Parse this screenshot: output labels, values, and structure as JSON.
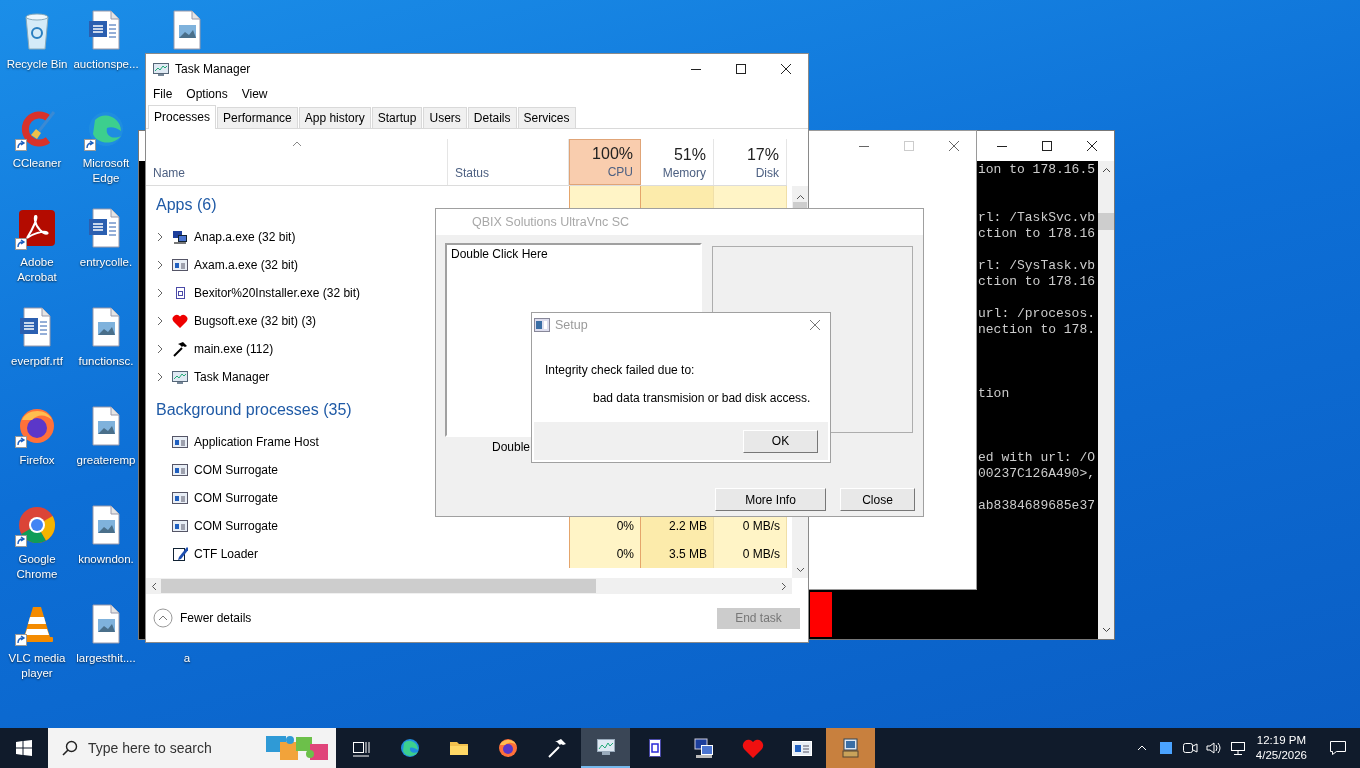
{
  "desktop": {
    "columns": [
      [
        {
          "label": "Recycle Bin",
          "kind": "system",
          "shortcut": false
        },
        {
          "label": "CCleaner",
          "kind": "app",
          "shortcut": true
        },
        {
          "label": "Adobe Acrobat",
          "kind": "app",
          "shortcut": true
        },
        {
          "label": "everpdf.rtf",
          "kind": "word",
          "shortcut": false
        },
        {
          "label": "Firefox",
          "kind": "app",
          "shortcut": true
        },
        {
          "label": "Google Chrome",
          "kind": "app",
          "shortcut": true
        },
        {
          "label": "VLC media player",
          "kind": "app",
          "shortcut": true
        }
      ],
      [
        {
          "label": "auctionspe...",
          "kind": "word",
          "shortcut": false
        },
        {
          "label": "Microsoft Edge",
          "kind": "app",
          "shortcut": true
        },
        {
          "label": "entrycolle.",
          "kind": "word",
          "shortcut": false
        },
        {
          "label": "functionsc.",
          "kind": "image",
          "shortcut": false
        },
        {
          "label": "greateremp",
          "kind": "image",
          "shortcut": false
        },
        {
          "label": "knowndon.",
          "kind": "image",
          "shortcut": false
        },
        {
          "label": "largesthit....",
          "kind": "image",
          "shortcut": false
        }
      ],
      [
        {
          "kind": "image",
          "shortcut": false
        },
        {
          "label": "a",
          "shortcut": false
        }
      ]
    ]
  },
  "console": {
    "lines": [
      "ion to 178.16.5",
      "rl: /TaskSvc.vb",
      "ction to 178.16",
      "rl: /SysTask.vb",
      "ction to 178.16",
      "url: /procesos.",
      "nection to 178.",
      "tion",
      "ed with url: /O",
      "00237C126A490>,",
      "ab8384689685e37"
    ]
  },
  "task_manager": {
    "title": "Task Manager",
    "menu": [
      "File",
      "Options",
      "View"
    ],
    "tabs": [
      {
        "label": "Processes",
        "selected": true
      },
      {
        "label": "Performance",
        "selected": false
      },
      {
        "label": "App history",
        "selected": false
      },
      {
        "label": "Startup",
        "selected": false
      },
      {
        "label": "Users",
        "selected": false
      },
      {
        "label": "Details",
        "selected": false
      },
      {
        "label": "Services",
        "selected": false
      }
    ],
    "columns": [
      {
        "label": "Name",
        "sorted": true
      },
      {
        "label": "Status",
        "sorted": false
      },
      {
        "percent": "100%",
        "label": "CPU",
        "sorted": false,
        "selected": true
      },
      {
        "percent": "51%",
        "label": "Memory",
        "sorted": false,
        "selected": false
      },
      {
        "percent": "17%",
        "label": "Disk",
        "sorted": false,
        "selected": false
      }
    ],
    "groups": [
      {
        "title": "Apps (6)",
        "rows": [
          {
            "name": "Anap.a.exe (32 bit)",
            "expanded": false
          },
          {
            "name": "Axam.a.exe (32 bit)",
            "expanded": false
          },
          {
            "name": "Bexitor%20Installer.exe (32 bit)",
            "expanded": false
          },
          {
            "name": "Bugsoft.exe (32 bit) (3)",
            "expanded": false
          },
          {
            "name": "main.exe (112)",
            "expanded": false
          },
          {
            "name": "Task Manager",
            "expanded": false
          }
        ]
      },
      {
        "title": "Background processes (35)",
        "rows": [
          {
            "name": "Application Frame Host"
          },
          {
            "name": "COM Surrogate"
          },
          {
            "name": "COM Surrogate"
          },
          {
            "name": "COM Surrogate",
            "cpu": "0%",
            "memory": "2.2 MB",
            "disk": "0 MB/s"
          },
          {
            "name": "CTF Loader",
            "cpu": "0%",
            "memory": "3.5 MB",
            "disk": "0 MB/s"
          }
        ]
      }
    ],
    "footer": {
      "toggle": "Fewer details",
      "end_task": {
        "label": "End task",
        "disabled": true
      }
    }
  },
  "vnc_window": {
    "title": "QBIX Solutions UltraVnc SC",
    "list_items": [
      "Double Click Here"
    ],
    "caption": "Double",
    "buttons": [
      "More Info",
      "Close"
    ]
  },
  "setup_dialog": {
    "title": "Setup",
    "message": "Integrity check failed due to:",
    "detail": "bad data transmision or bad disk access.",
    "button": "OK"
  },
  "taskbar": {
    "search_placeholder": "Type here to search",
    "apps": [
      {
        "active": false,
        "attention": false
      },
      {
        "active": false,
        "attention": false
      },
      {
        "active": false,
        "attention": false
      },
      {
        "active": false,
        "attention": false
      },
      {
        "active": false,
        "attention": false
      },
      {
        "active": true,
        "attention": false
      },
      {
        "active": false,
        "attention": false
      },
      {
        "active": false,
        "attention": false
      },
      {
        "active": false,
        "attention": false
      },
      {
        "active": false,
        "attention": false
      },
      {
        "active": false,
        "attention": true
      }
    ],
    "time": "12:19 PM",
    "date": "4/25/2026"
  }
}
